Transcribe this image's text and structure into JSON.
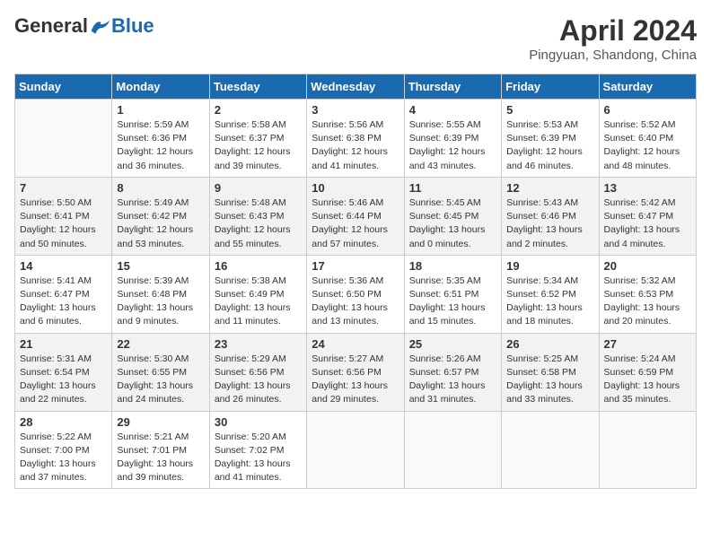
{
  "header": {
    "logo_general": "General",
    "logo_blue": "Blue",
    "month_title": "April 2024",
    "location": "Pingyuan, Shandong, China"
  },
  "days_of_week": [
    "Sunday",
    "Monday",
    "Tuesday",
    "Wednesday",
    "Thursday",
    "Friday",
    "Saturday"
  ],
  "weeks": [
    [
      {
        "day": "",
        "info": ""
      },
      {
        "day": "1",
        "info": "Sunrise: 5:59 AM\nSunset: 6:36 PM\nDaylight: 12 hours\nand 36 minutes."
      },
      {
        "day": "2",
        "info": "Sunrise: 5:58 AM\nSunset: 6:37 PM\nDaylight: 12 hours\nand 39 minutes."
      },
      {
        "day": "3",
        "info": "Sunrise: 5:56 AM\nSunset: 6:38 PM\nDaylight: 12 hours\nand 41 minutes."
      },
      {
        "day": "4",
        "info": "Sunrise: 5:55 AM\nSunset: 6:39 PM\nDaylight: 12 hours\nand 43 minutes."
      },
      {
        "day": "5",
        "info": "Sunrise: 5:53 AM\nSunset: 6:39 PM\nDaylight: 12 hours\nand 46 minutes."
      },
      {
        "day": "6",
        "info": "Sunrise: 5:52 AM\nSunset: 6:40 PM\nDaylight: 12 hours\nand 48 minutes."
      }
    ],
    [
      {
        "day": "7",
        "info": "Sunrise: 5:50 AM\nSunset: 6:41 PM\nDaylight: 12 hours\nand 50 minutes."
      },
      {
        "day": "8",
        "info": "Sunrise: 5:49 AM\nSunset: 6:42 PM\nDaylight: 12 hours\nand 53 minutes."
      },
      {
        "day": "9",
        "info": "Sunrise: 5:48 AM\nSunset: 6:43 PM\nDaylight: 12 hours\nand 55 minutes."
      },
      {
        "day": "10",
        "info": "Sunrise: 5:46 AM\nSunset: 6:44 PM\nDaylight: 12 hours\nand 57 minutes."
      },
      {
        "day": "11",
        "info": "Sunrise: 5:45 AM\nSunset: 6:45 PM\nDaylight: 13 hours\nand 0 minutes."
      },
      {
        "day": "12",
        "info": "Sunrise: 5:43 AM\nSunset: 6:46 PM\nDaylight: 13 hours\nand 2 minutes."
      },
      {
        "day": "13",
        "info": "Sunrise: 5:42 AM\nSunset: 6:47 PM\nDaylight: 13 hours\nand 4 minutes."
      }
    ],
    [
      {
        "day": "14",
        "info": "Sunrise: 5:41 AM\nSunset: 6:47 PM\nDaylight: 13 hours\nand 6 minutes."
      },
      {
        "day": "15",
        "info": "Sunrise: 5:39 AM\nSunset: 6:48 PM\nDaylight: 13 hours\nand 9 minutes."
      },
      {
        "day": "16",
        "info": "Sunrise: 5:38 AM\nSunset: 6:49 PM\nDaylight: 13 hours\nand 11 minutes."
      },
      {
        "day": "17",
        "info": "Sunrise: 5:36 AM\nSunset: 6:50 PM\nDaylight: 13 hours\nand 13 minutes."
      },
      {
        "day": "18",
        "info": "Sunrise: 5:35 AM\nSunset: 6:51 PM\nDaylight: 13 hours\nand 15 minutes."
      },
      {
        "day": "19",
        "info": "Sunrise: 5:34 AM\nSunset: 6:52 PM\nDaylight: 13 hours\nand 18 minutes."
      },
      {
        "day": "20",
        "info": "Sunrise: 5:32 AM\nSunset: 6:53 PM\nDaylight: 13 hours\nand 20 minutes."
      }
    ],
    [
      {
        "day": "21",
        "info": "Sunrise: 5:31 AM\nSunset: 6:54 PM\nDaylight: 13 hours\nand 22 minutes."
      },
      {
        "day": "22",
        "info": "Sunrise: 5:30 AM\nSunset: 6:55 PM\nDaylight: 13 hours\nand 24 minutes."
      },
      {
        "day": "23",
        "info": "Sunrise: 5:29 AM\nSunset: 6:56 PM\nDaylight: 13 hours\nand 26 minutes."
      },
      {
        "day": "24",
        "info": "Sunrise: 5:27 AM\nSunset: 6:56 PM\nDaylight: 13 hours\nand 29 minutes."
      },
      {
        "day": "25",
        "info": "Sunrise: 5:26 AM\nSunset: 6:57 PM\nDaylight: 13 hours\nand 31 minutes."
      },
      {
        "day": "26",
        "info": "Sunrise: 5:25 AM\nSunset: 6:58 PM\nDaylight: 13 hours\nand 33 minutes."
      },
      {
        "day": "27",
        "info": "Sunrise: 5:24 AM\nSunset: 6:59 PM\nDaylight: 13 hours\nand 35 minutes."
      }
    ],
    [
      {
        "day": "28",
        "info": "Sunrise: 5:22 AM\nSunset: 7:00 PM\nDaylight: 13 hours\nand 37 minutes."
      },
      {
        "day": "29",
        "info": "Sunrise: 5:21 AM\nSunset: 7:01 PM\nDaylight: 13 hours\nand 39 minutes."
      },
      {
        "day": "30",
        "info": "Sunrise: 5:20 AM\nSunset: 7:02 PM\nDaylight: 13 hours\nand 41 minutes."
      },
      {
        "day": "",
        "info": ""
      },
      {
        "day": "",
        "info": ""
      },
      {
        "day": "",
        "info": ""
      },
      {
        "day": "",
        "info": ""
      }
    ]
  ]
}
